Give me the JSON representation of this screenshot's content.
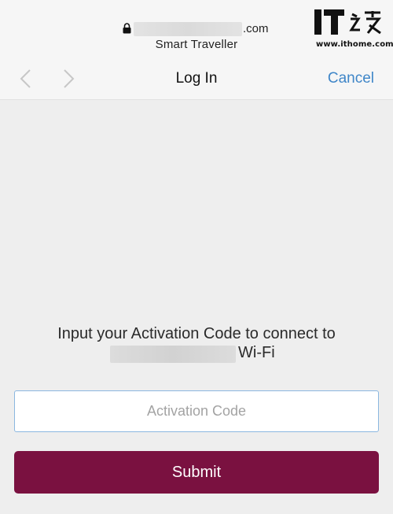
{
  "browser": {
    "domain_suffix": ".com",
    "site_name": "Smart Traveller"
  },
  "nav": {
    "title": "Log In",
    "cancel_label": "Cancel",
    "back_icon": "chevron-left-icon",
    "forward_icon": "chevron-right-icon",
    "lock_icon": "lock-icon"
  },
  "watermark": {
    "logo": "IT之家",
    "url": "www.ithome.com"
  },
  "form": {
    "prompt_line1": "Input your Activation Code to connect to",
    "prompt_wifi": "Wi-Fi",
    "activation_placeholder": "Activation Code",
    "activation_value": "",
    "submit_label": "Submit"
  },
  "colors": {
    "accent": "#3f86c8",
    "brand": "#7a1140",
    "input_border": "#8bb7e0"
  }
}
